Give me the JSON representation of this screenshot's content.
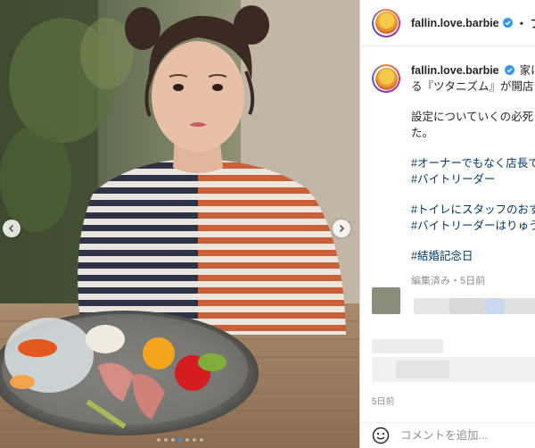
{
  "post": {
    "username": "fallin.love.barbie",
    "follow_text": "・ フォ",
    "verified_icon": "verified-badge-icon",
    "accent_color": "#3897f0"
  },
  "caption": {
    "line1": "家に",
    "line2": "る『ツタニズム』が開店",
    "paragraph1_line1": "設定についていくの必死",
    "paragraph1_line2": "た。",
    "tags_group1": [
      "#オーナーでもなく店長で",
      "#バイトリーダー"
    ],
    "tags_group2": [
      "#トイレにスタッフのおす",
      "#バイトリーダーはりゅう"
    ],
    "tag_anniversary": "#結婚記念日",
    "meta": "編集済み・5日前"
  },
  "footer": {
    "time": "5日前",
    "comment_placeholder": "コメントを追加..."
  },
  "carousel": {
    "total_slides": 7,
    "active_index": 3
  }
}
